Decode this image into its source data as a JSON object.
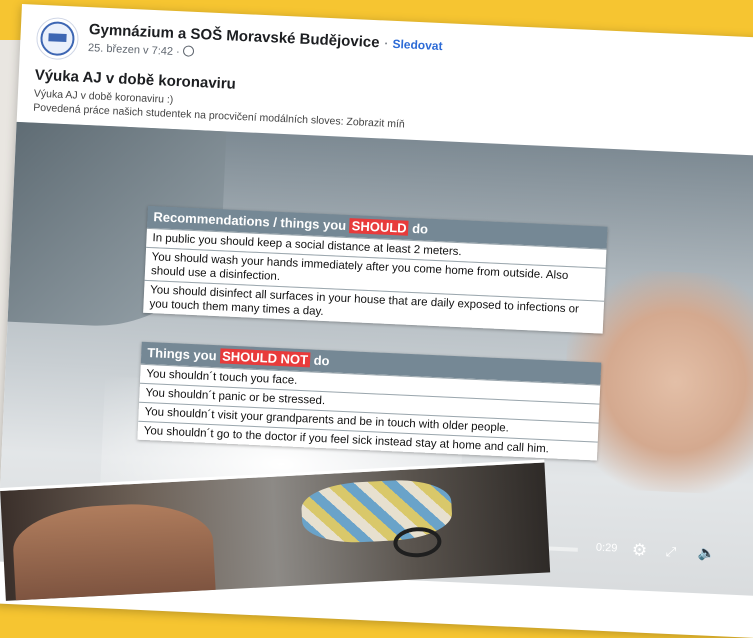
{
  "post": {
    "page_name": "Gymnázium a SOŠ Moravské Budějovice",
    "separator": "·",
    "follow_label": "Sledovat",
    "timestamp": "25. březen v 7:42 ·",
    "title": "Výuka AJ v době koronaviru",
    "desc_line1": "Výuka AJ v době koronaviru :)",
    "desc_line2": "Povedená práce našich studentek na procvičení modálních sloves: Zobrazit míň"
  },
  "table_should": {
    "header_pre": "Recommendations / things you ",
    "header_hl": "SHOULD",
    "header_post": " do",
    "rows": [
      "In public you should keep a social distance at least 2 meters.",
      "You should wash your hands immediately after you come home from outside. Also should use a disinfection.",
      "You should disinfect all surfaces in your house that are daily exposed to infections or you touch them many times a day."
    ]
  },
  "table_should_not": {
    "header_pre": "Things you ",
    "header_hl": "SHOULD NOT",
    "header_post": " do",
    "rows": [
      "You shouldn´t touch you face.",
      "You shouldn´t panic or be stressed.",
      "You shouldn´t visit your grandparents and be in touch with older people.",
      "You shouldn´t go to the doctor if you feel sick instead stay at home and call him."
    ]
  },
  "video": {
    "time": "0:29",
    "progress": 0.06
  },
  "colors": {
    "background": "#f6c531",
    "table_header": "#758895",
    "highlight": "#e83b3b",
    "link": "#2d6bd6"
  }
}
